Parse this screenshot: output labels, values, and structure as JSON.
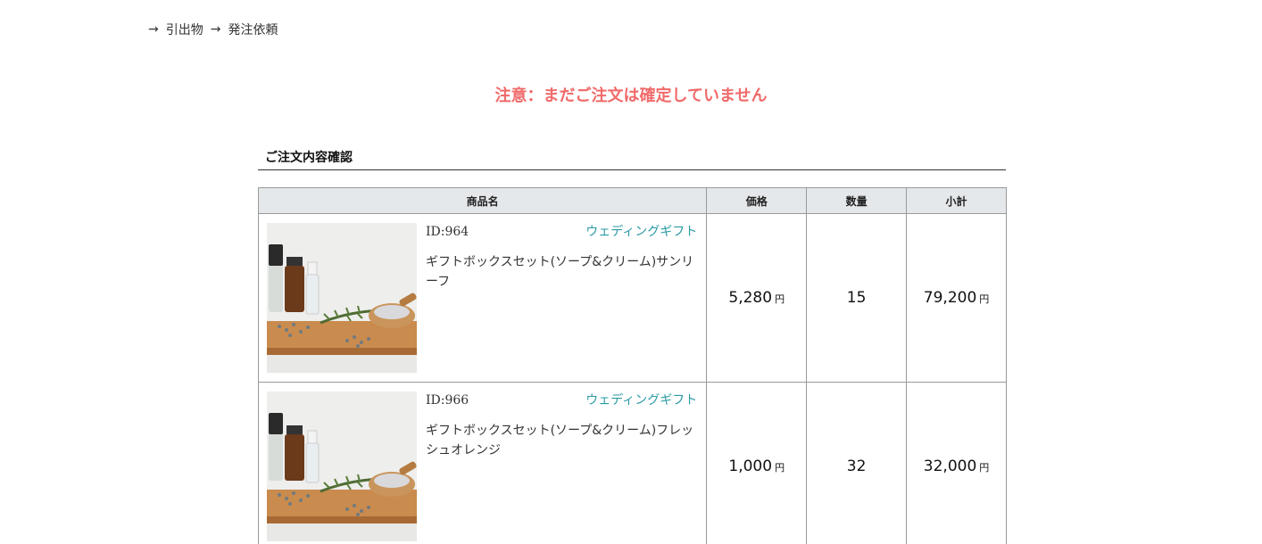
{
  "breadcrumb": {
    "items": [
      "引出物",
      "発注依頼"
    ]
  },
  "warning": "注意：まだご注文は確定していません",
  "section_title": "ご注文内容確認",
  "table": {
    "headers": {
      "name": "商品名",
      "price": "価格",
      "qty": "数量",
      "subtotal": "小計"
    },
    "yen": "円",
    "rows": [
      {
        "id": "ID:964",
        "category": "ウェディングギフト",
        "name": "ギフトボックスセット(ソープ&クリーム)サンリーフ",
        "price": "5,280",
        "qty": "15",
        "subtotal": "79,200"
      },
      {
        "id": "ID:966",
        "category": "ウェディングギフト",
        "name": "ギフトボックスセット(ソープ&クリーム)フレッシュオレンジ",
        "price": "1,000",
        "qty": "32",
        "subtotal": "32,000"
      }
    ]
  },
  "colors": {
    "warning": "#f06a6a",
    "category": "#2a9aa5",
    "header_bg": "#e5e8ea"
  }
}
